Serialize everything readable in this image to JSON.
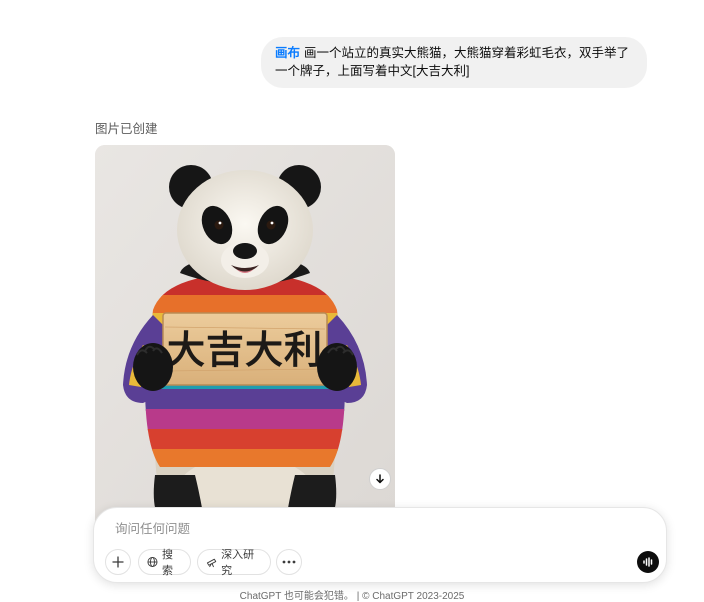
{
  "conversation": {
    "user_message": {
      "tag": "画布",
      "text": "画一个站立的真实大熊猫，大熊猫穿着彩虹毛衣，双手举了一个牌子，上面写着中文[大吉大利]"
    },
    "assistant": {
      "status": "图片已创建",
      "image_sign_text": "大吉大利"
    }
  },
  "composer": {
    "placeholder": "询问任何问题",
    "buttons": {
      "search_label": "搜索",
      "research_label": "深入研究"
    }
  },
  "footer": {
    "note": "ChatGPT 也可能会犯错。 | © ChatGPT 2023-2025"
  },
  "icons": {
    "add": "plus-icon",
    "search": "globe-icon",
    "research": "telescope-icon",
    "more": "more-icon",
    "voice": "voice-mode-icon",
    "download": "download-icon"
  },
  "colors": {
    "canvas_tag": "#0a7cff",
    "bubble_bg": "#f1f1f1",
    "voice_button": "#0d0d0d"
  }
}
